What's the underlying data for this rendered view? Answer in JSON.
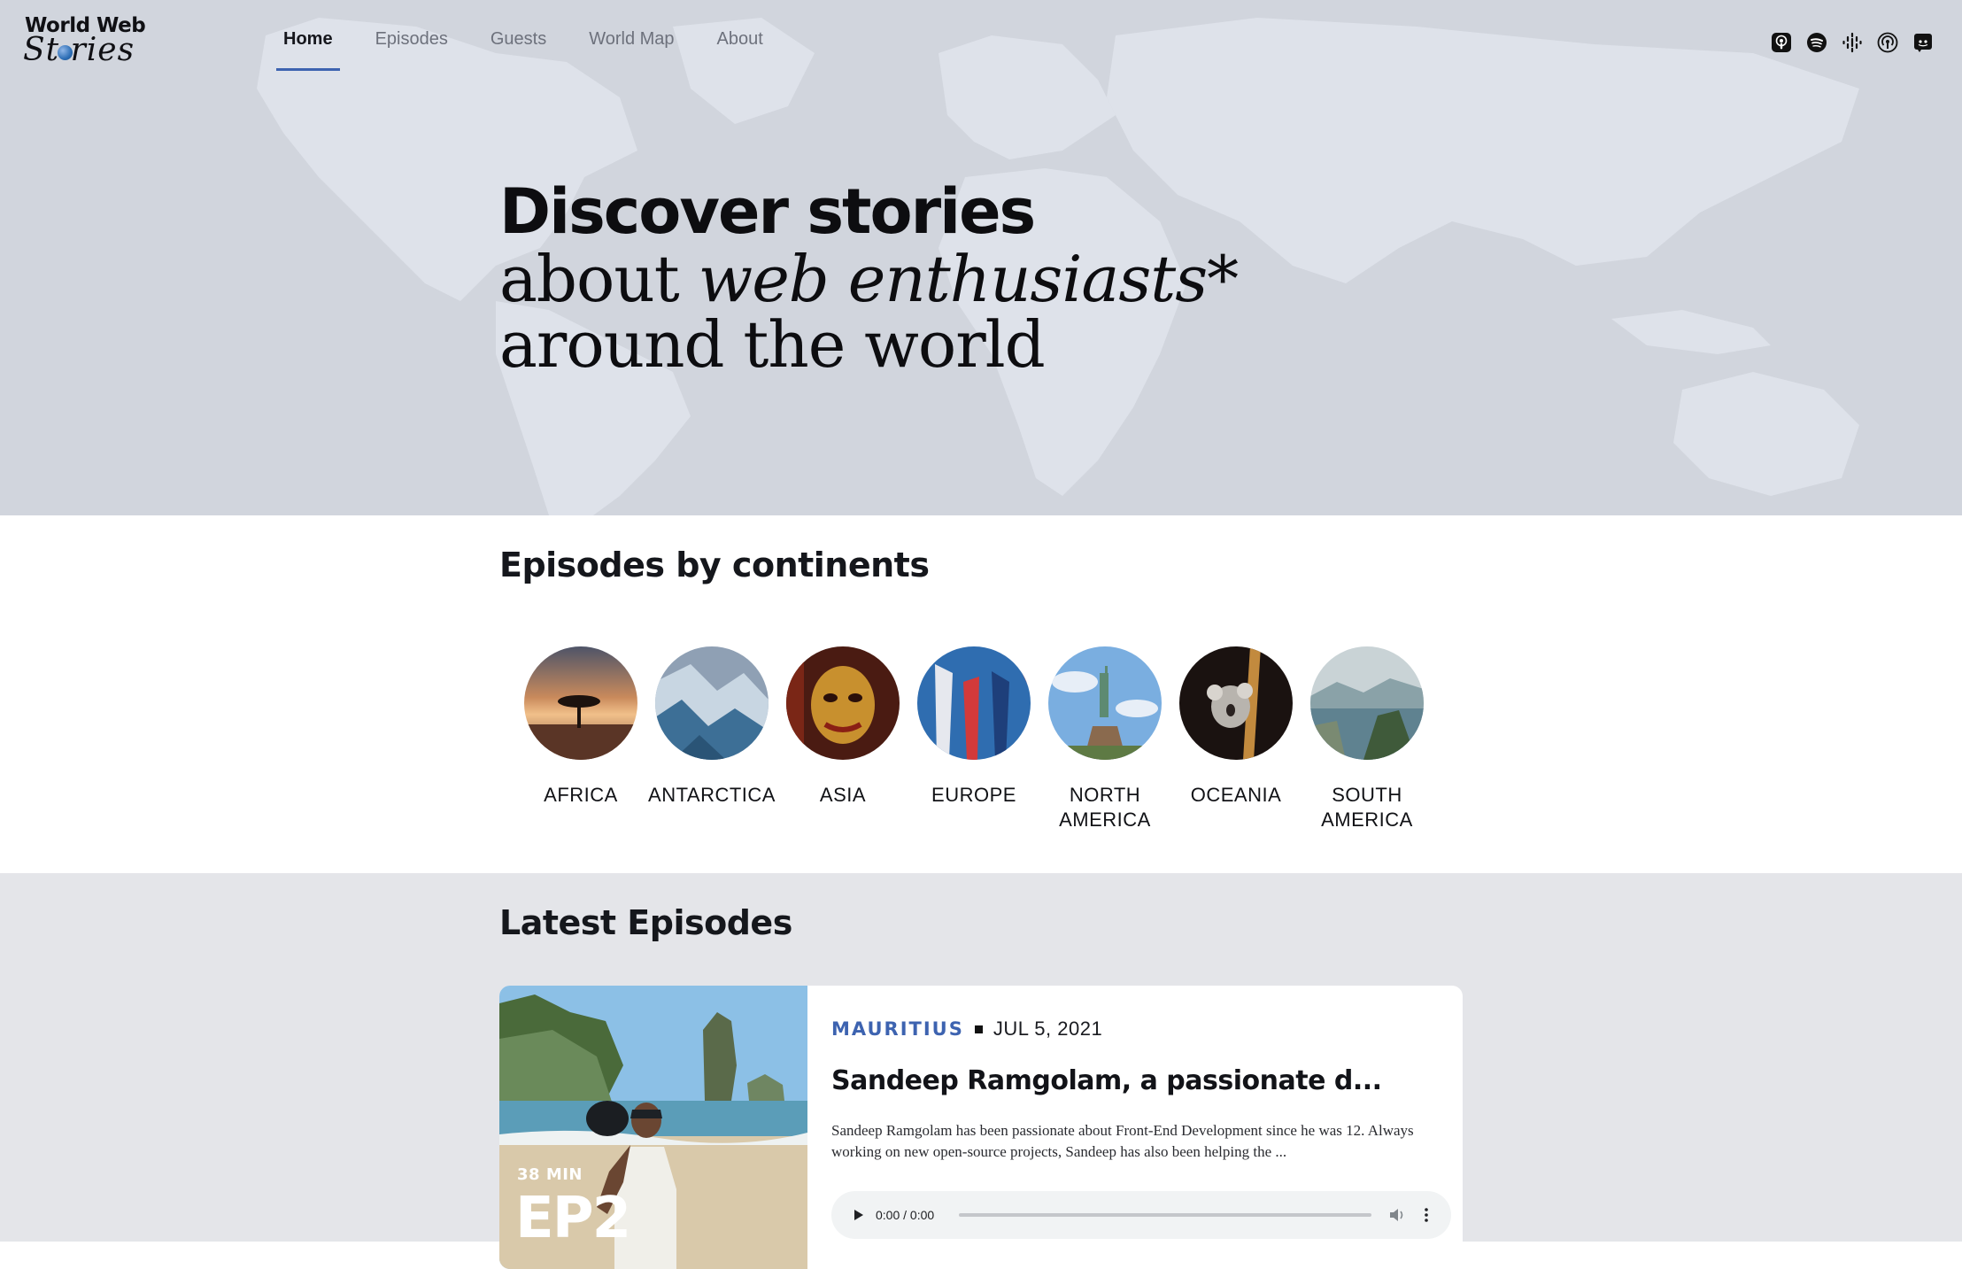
{
  "logo": {
    "line1": "World Web",
    "line2": "St ries"
  },
  "nav": {
    "items": [
      {
        "label": "Home",
        "active": true
      },
      {
        "label": "Episodes",
        "active": false
      },
      {
        "label": "Guests",
        "active": false
      },
      {
        "label": "World Map",
        "active": false
      },
      {
        "label": "About",
        "active": false
      }
    ]
  },
  "social": {
    "icons": [
      "apple-podcasts-icon",
      "spotify-icon",
      "google-podcasts-icon",
      "podcast-broadcast-icon",
      "discord-icon"
    ]
  },
  "hero": {
    "line1": "Discover stories",
    "line2_prefix": "about ",
    "line2_em": "web enthusiasts*",
    "line3": "around the world"
  },
  "continents": {
    "title": "Episodes by continents",
    "items": [
      {
        "label": "AFRICA",
        "image": "acacia-sunset"
      },
      {
        "label": "ANTARCTICA",
        "image": "ice-cliffs"
      },
      {
        "label": "ASIA",
        "image": "golden-mask"
      },
      {
        "label": "EUROPE",
        "image": "flags-blue-sky"
      },
      {
        "label": "NORTH AMERICA",
        "image": "statue-of-liberty"
      },
      {
        "label": "OCEANIA",
        "image": "koala"
      },
      {
        "label": "SOUTH AMERICA",
        "image": "coastal-city"
      }
    ]
  },
  "latest": {
    "title": "Latest Episodes",
    "episode": {
      "duration": "38 MIN",
      "number": "EP2",
      "country": "MAURITIUS",
      "date": "JUL 5, 2021",
      "title": "Sandeep Ramgolam, a passionate d...",
      "description": "Sandeep Ramgolam has been passionate about Front-End Development since he was 12. Always working on new open-source projects, Sandeep has also been helping the ...",
      "player_time": "0:00 / 0:00"
    }
  },
  "colors": {
    "accent": "#3d63b0",
    "hero_bg": "#d1d5dd",
    "latest_bg": "#e4e5e9"
  }
}
